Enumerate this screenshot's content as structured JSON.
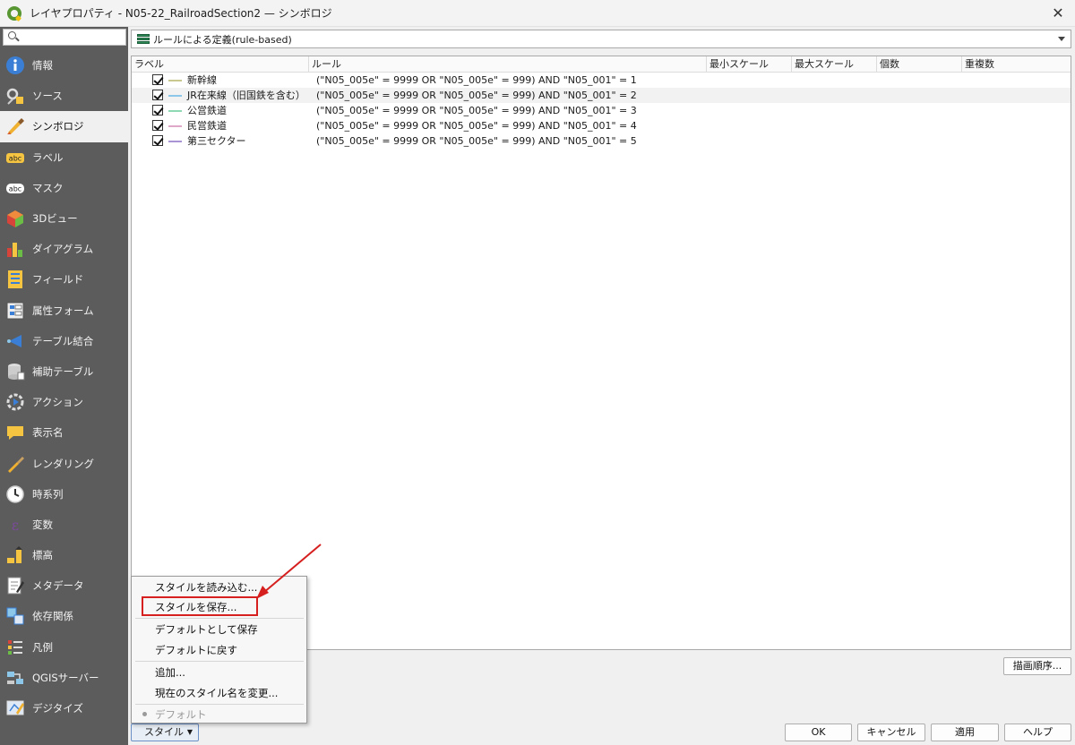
{
  "window": {
    "title": "レイヤプロパティ - N05-22_RailroadSection2 — シンボロジ",
    "close": "✕"
  },
  "sidebar": {
    "search_placeholder": "",
    "items": [
      {
        "label": "情報",
        "icon": "info-icon"
      },
      {
        "label": "ソース",
        "icon": "source-icon"
      },
      {
        "label": "シンボロジ",
        "icon": "symbology-icon",
        "active": true
      },
      {
        "label": "ラベル",
        "icon": "labels-icon"
      },
      {
        "label": "マスク",
        "icon": "mask-icon"
      },
      {
        "label": "3Dビュー",
        "icon": "3d-view-icon"
      },
      {
        "label": "ダイアグラム",
        "icon": "diagram-icon"
      },
      {
        "label": "フィールド",
        "icon": "fields-icon"
      },
      {
        "label": "属性フォーム",
        "icon": "attribute-form-icon"
      },
      {
        "label": "テーブル結合",
        "icon": "join-icon"
      },
      {
        "label": "補助テーブル",
        "icon": "auxiliary-storage-icon"
      },
      {
        "label": "アクション",
        "icon": "action-icon"
      },
      {
        "label": "表示名",
        "icon": "display-icon"
      },
      {
        "label": "レンダリング",
        "icon": "rendering-icon"
      },
      {
        "label": "時系列",
        "icon": "temporal-icon"
      },
      {
        "label": "変数",
        "icon": "variables-icon"
      },
      {
        "label": "標高",
        "icon": "elevation-icon"
      },
      {
        "label": "メタデータ",
        "icon": "metadata-icon"
      },
      {
        "label": "依存関係",
        "icon": "dependencies-icon"
      },
      {
        "label": "凡例",
        "icon": "legend-icon"
      },
      {
        "label": "QGISサーバー",
        "icon": "qgis-server-icon"
      },
      {
        "label": "デジタイズ",
        "icon": "digitizing-icon"
      }
    ]
  },
  "renderer": {
    "selected": "ルールによる定義(rule-based)"
  },
  "rules_table": {
    "columns": [
      "ラベル",
      "ルール",
      "最小スケール",
      "最大スケール",
      "個数",
      "重複数"
    ],
    "rows": [
      {
        "label": "新幹線",
        "rule": "(\"N05_005e\" = 9999  OR  \"N05_005e\" = 999) AND \"N05_001\" = 1",
        "color": "#c9c98f",
        "checked": true
      },
      {
        "label": "JR在来線（旧国鉄を含む）",
        "rule": "(\"N05_005e\" = 9999  OR  \"N05_005e\" = 999) AND \"N05_001\" = 2",
        "color": "#8cc6e8",
        "checked": true
      },
      {
        "label": "公営鉄道",
        "rule": "(\"N05_005e\" = 9999  OR  \"N05_005e\" = 999) AND \"N05_001\" = 3",
        "color": "#8fd9b4",
        "checked": true
      },
      {
        "label": "民営鉄道",
        "rule": "(\"N05_005e\" = 9999  OR  \"N05_005e\" = 999) AND \"N05_001\" = 4",
        "color": "#e0a8c8",
        "checked": true
      },
      {
        "label": "第三セクター",
        "rule": "(\"N05_005e\" = 9999  OR  \"N05_005e\" = 999) AND \"N05_001\" = 5",
        "color": "#a994d6",
        "checked": true
      }
    ]
  },
  "style_menu": {
    "items": [
      {
        "label": "スタイルを読み込む..."
      },
      {
        "label": "スタイルを保存..."
      },
      {
        "label": "デフォルトとして保存"
      },
      {
        "label": "デフォルトに戻す"
      },
      {
        "label": "追加..."
      },
      {
        "label": "現在のスタイル名を変更..."
      },
      {
        "label": "デフォルト",
        "disabled": true
      }
    ]
  },
  "buttons": {
    "style": "スタイル",
    "render_order": "描画順序...",
    "ok": "OK",
    "cancel": "キャンセル",
    "apply": "適用",
    "help": "ヘルプ"
  },
  "annotation_color": "#d61f1f"
}
